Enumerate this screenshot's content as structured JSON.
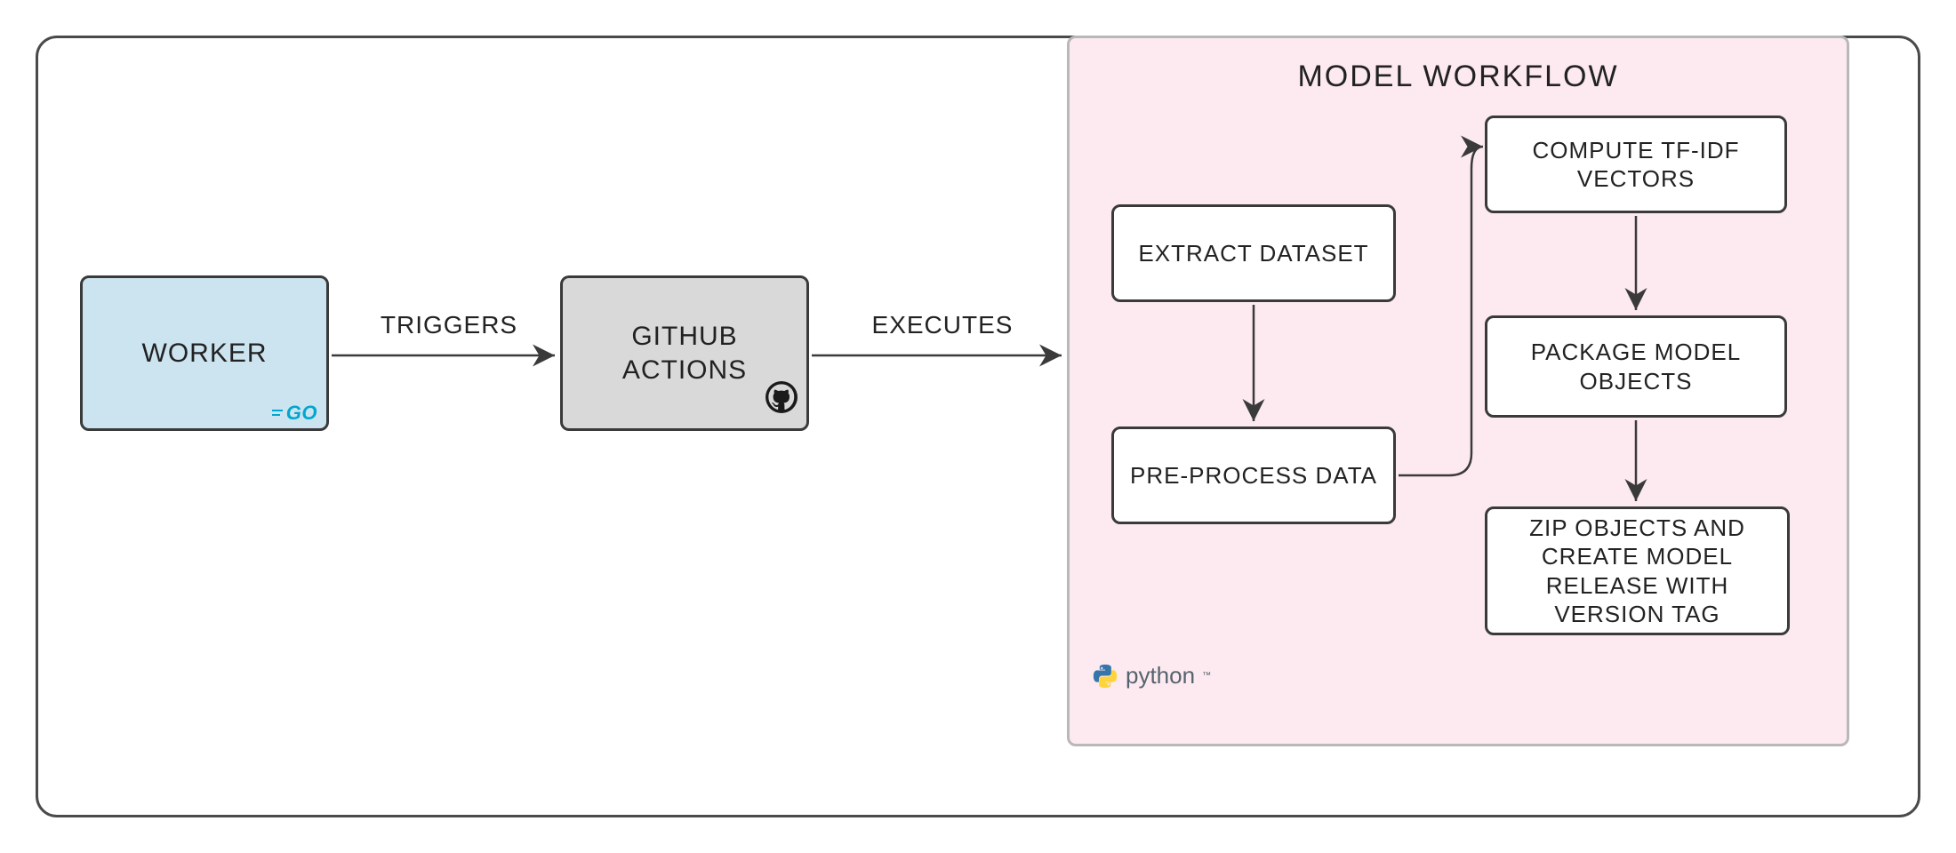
{
  "diagram": {
    "worker": {
      "label": "WORKER",
      "badge": "GO"
    },
    "github": {
      "label": "GITHUB ACTIONS"
    },
    "edges": {
      "triggers": "TRIGGERS",
      "executes": "EXECUTES"
    },
    "workflow": {
      "title": "MODEL WORKFLOW",
      "badge": "python",
      "steps": {
        "extract": "EXTRACT DATASET",
        "preprocess": "PRE-PROCESS DATA",
        "tfidf": "COMPUTE TF-IDF VECTORS",
        "package": "PACKAGE MODEL OBJECTS",
        "zip": "ZIP OBJECTS AND CREATE MODEL RELEASE WITH VERSION TAG"
      }
    }
  },
  "colors": {
    "worker_bg": "#cbe4f0",
    "github_bg": "#d9d9d9",
    "workflow_bg": "#fdeaf0",
    "stroke": "#3a3a3a"
  }
}
